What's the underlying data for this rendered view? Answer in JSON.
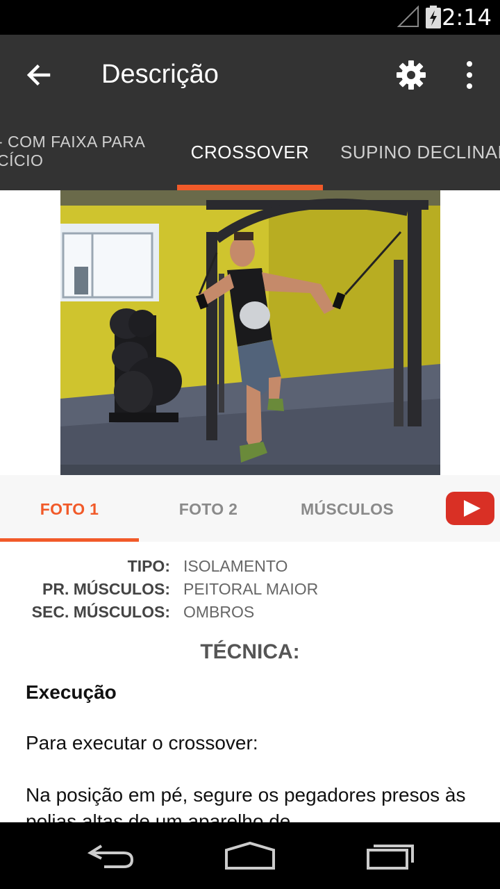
{
  "status_bar": {
    "time": "2:14"
  },
  "app_bar": {
    "title": "Descrição"
  },
  "tabs": {
    "previous": "- COM FAIXA PARA\nCÍCIO",
    "current": "CROSSOVER",
    "next": "SUPINO DECLINADO"
  },
  "photo_tabs": [
    {
      "label": "FOTO 1"
    },
    {
      "label": "FOTO 2"
    },
    {
      "label": "MÚSCULOS"
    }
  ],
  "details": [
    {
      "label": "TIPO:",
      "value": "ISOLAMENTO"
    },
    {
      "label": "PR. MÚSCULOS:",
      "value": "PEITORAL MAIOR"
    },
    {
      "label": "SEC. MÚSCULOS:",
      "value": "OMBROS"
    }
  ],
  "technique": {
    "heading": "TÉCNICA:",
    "section_title": "Execução",
    "paragraph1": "Para executar o crossover:",
    "paragraph2": "Na posição em pé, segure os pegadores presos às polias altas de um aparelho de"
  },
  "colors": {
    "accent": "#f15a29",
    "app_bar": "#333333",
    "youtube_red": "#d93025"
  },
  "icons": [
    "signal-icon",
    "battery-icon",
    "back-arrow-icon",
    "settings-icon",
    "overflow-menu-icon",
    "youtube-icon",
    "nav-back-icon",
    "nav-home-icon",
    "nav-recents-icon"
  ]
}
